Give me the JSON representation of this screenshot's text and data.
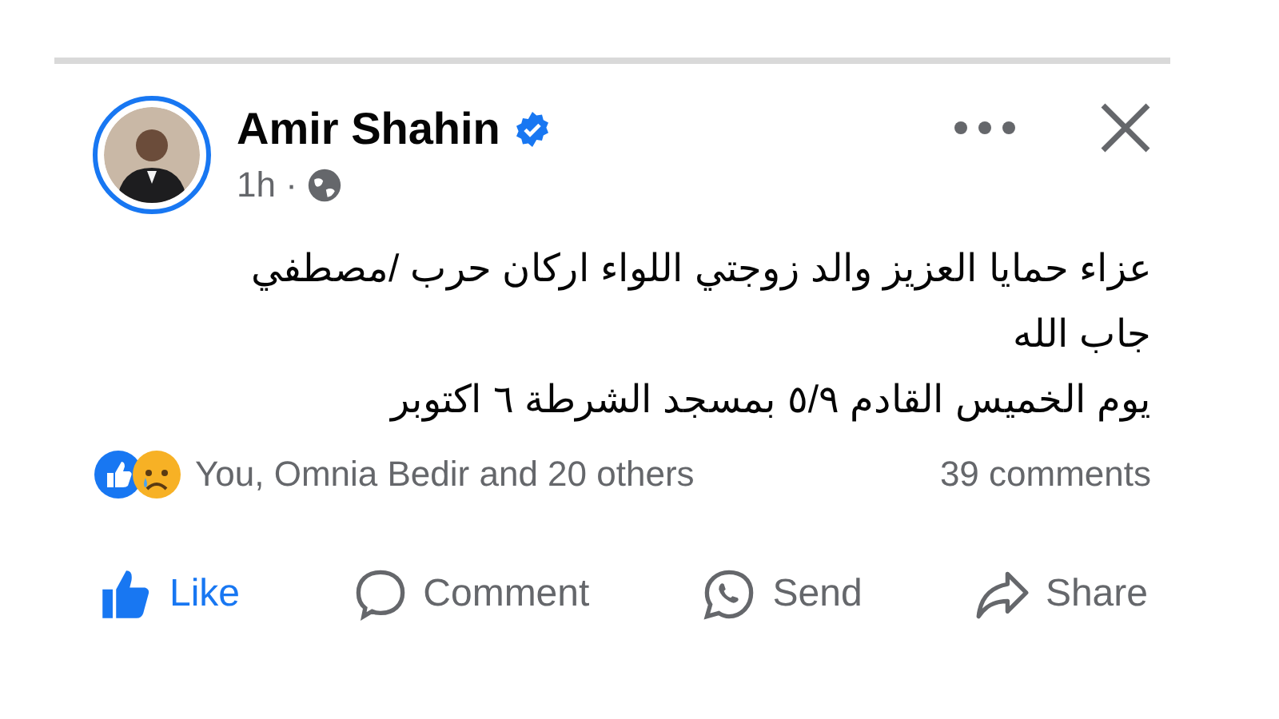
{
  "post": {
    "author": "Amir Shahin",
    "verified": true,
    "time": "1h ·",
    "text_lines": [
      "عزاء حمايا العزيز والد زوجتي اللواء اركان حرب /مصطفي",
      "جاب الله",
      "يوم الخميس القادم ٥/٩ بمسجد الشرطة ٦ اكتوبر"
    ],
    "reactions_text": "You, Omnia Bedir and 20 others",
    "comments": "39 comments",
    "actions": [
      {
        "kind": "like",
        "label": "Like",
        "selected": true
      },
      {
        "kind": "comment",
        "label": "Comment",
        "selected": false
      },
      {
        "kind": "send",
        "label": "Send",
        "selected": false
      },
      {
        "kind": "share",
        "label": "Share",
        "selected": false
      }
    ]
  }
}
